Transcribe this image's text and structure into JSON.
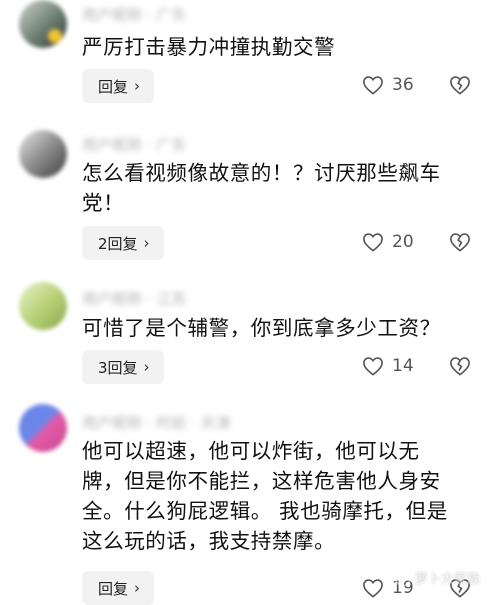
{
  "comments": [
    {
      "meta": "用户昵称 · 广东",
      "text": "严厉打击暴力冲撞执勤交警",
      "reply_label": "回复",
      "likes": "36"
    },
    {
      "meta": "用户昵称 · 广东",
      "text": "怎么看视频像故意的！？讨厌那些飙车党！",
      "reply_label": "2回复",
      "likes": "20"
    },
    {
      "meta": "用户昵称 · 江苏",
      "text": "可惜了是个辅警，你到底拿多少工资？",
      "reply_label": "3回复",
      "likes": "14"
    },
    {
      "meta": "用户昵称 · 时前 · 天津",
      "text": "他可以超速，他可以炸街，他可以无牌，但是你不能拦，这样危害他人身安全。什么狗屁逻辑。 我也骑摩托，但是这么玩的话，我支持禁摩。",
      "reply_label": "回复",
      "likes": "19"
    }
  ],
  "icons": {
    "like": "heart-outline-icon",
    "dislike": "broken-heart-icon",
    "reply_arrow": "chevron-right-icon"
  },
  "watermark": "萝卜大家族"
}
